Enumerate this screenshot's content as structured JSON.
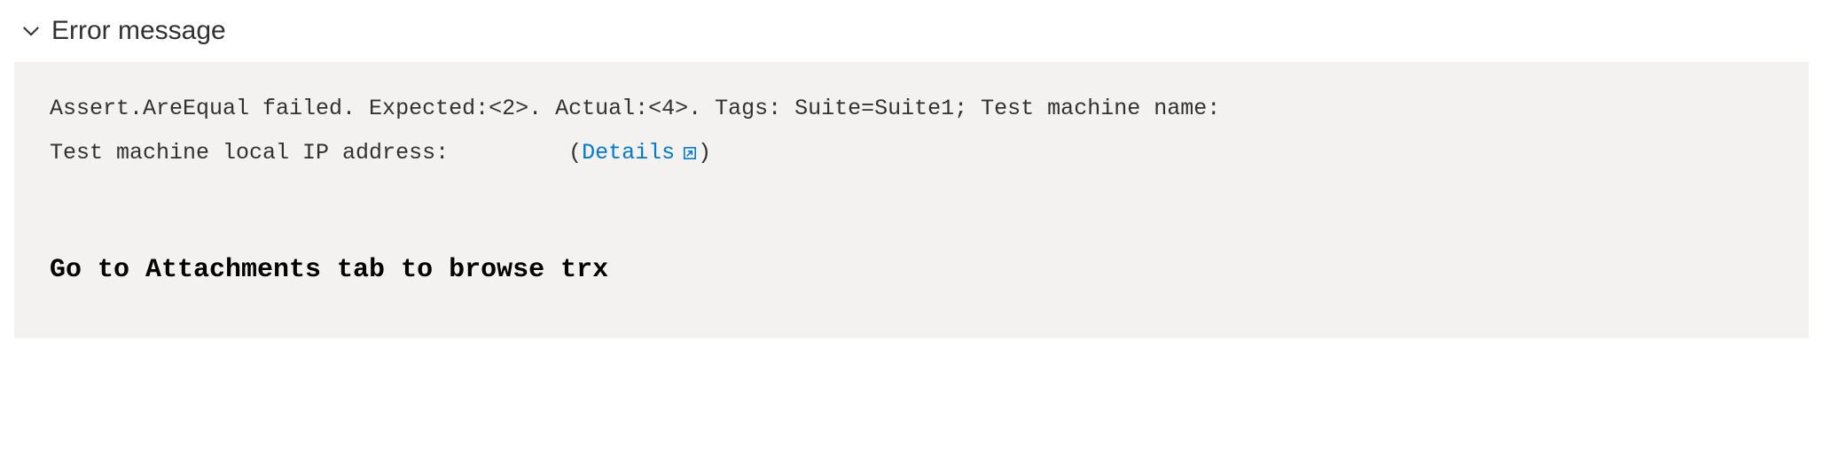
{
  "section": {
    "title": "Error message"
  },
  "error": {
    "line1": "Assert.AreEqual failed. Expected:<2>. Actual:<4>. Tags: Suite=Suite1; Test machine name:",
    "line2_prefix": "Test machine local IP address:         ",
    "details_label": "Details",
    "paren_open": "(",
    "paren_close": ")"
  },
  "hint": {
    "text": "Go to Attachments tab to browse trx"
  }
}
